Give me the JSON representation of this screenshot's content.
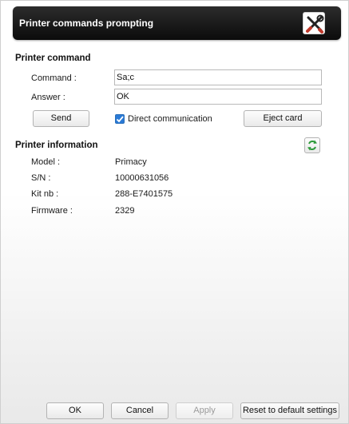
{
  "window": {
    "title": "Printer commands prompting",
    "icon": "tools-icon"
  },
  "printer_command": {
    "section_title": "Printer command",
    "command_label": "Command :",
    "command_value": "Sa;c",
    "answer_label": "Answer :",
    "answer_value": "OK",
    "send_label": "Send",
    "direct_label": "Direct communication",
    "direct_checked": true,
    "eject_label": "Eject card"
  },
  "printer_info": {
    "section_title": "Printer information",
    "refresh_icon": "refresh-icon",
    "rows": [
      {
        "label": "Model :",
        "value": "Primacy"
      },
      {
        "label": "S/N :",
        "value": "10000631056"
      },
      {
        "label": "Kit nb :",
        "value": "288-E7401575"
      },
      {
        "label": "Firmware :",
        "value": "2329"
      }
    ]
  },
  "footer": {
    "ok_label": "OK",
    "cancel_label": "Cancel",
    "apply_label": "Apply",
    "reset_label": "Reset to default settings"
  },
  "colors": {
    "titlebar": "#111111",
    "checkbox_accent": "#2a7ad6",
    "refresh_green": "#2e9a3a",
    "tool_red": "#c0392b"
  }
}
